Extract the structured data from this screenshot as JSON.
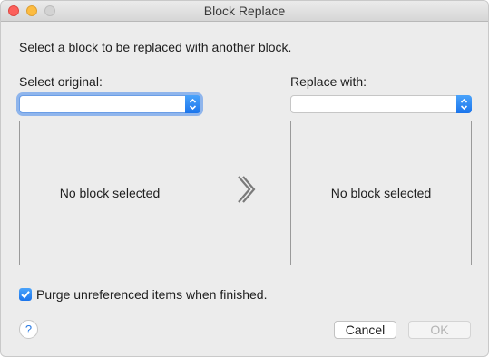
{
  "window": {
    "title": "Block Replace"
  },
  "instruction": "Select a block to be replaced with another block.",
  "original": {
    "label": "Select original:",
    "selected_value": "",
    "preview_text": "No block selected"
  },
  "replacement": {
    "label": "Replace with:",
    "selected_value": "",
    "preview_text": "No block selected"
  },
  "options": {
    "purge_label": "Purge unreferenced items when finished.",
    "purge_checked": true
  },
  "buttons": {
    "help_label": "?",
    "cancel_label": "Cancel",
    "ok_label": "OK"
  },
  "icons": {
    "arrow": "double-chevron-right-icon",
    "stepper": "up-down-chevron-icon",
    "check": "checkmark-icon"
  },
  "colors": {
    "accent": "#1a74ec",
    "close": "#fc605b",
    "minimize": "#fdbc40",
    "zoom_disabled": "#d3d3d3"
  }
}
